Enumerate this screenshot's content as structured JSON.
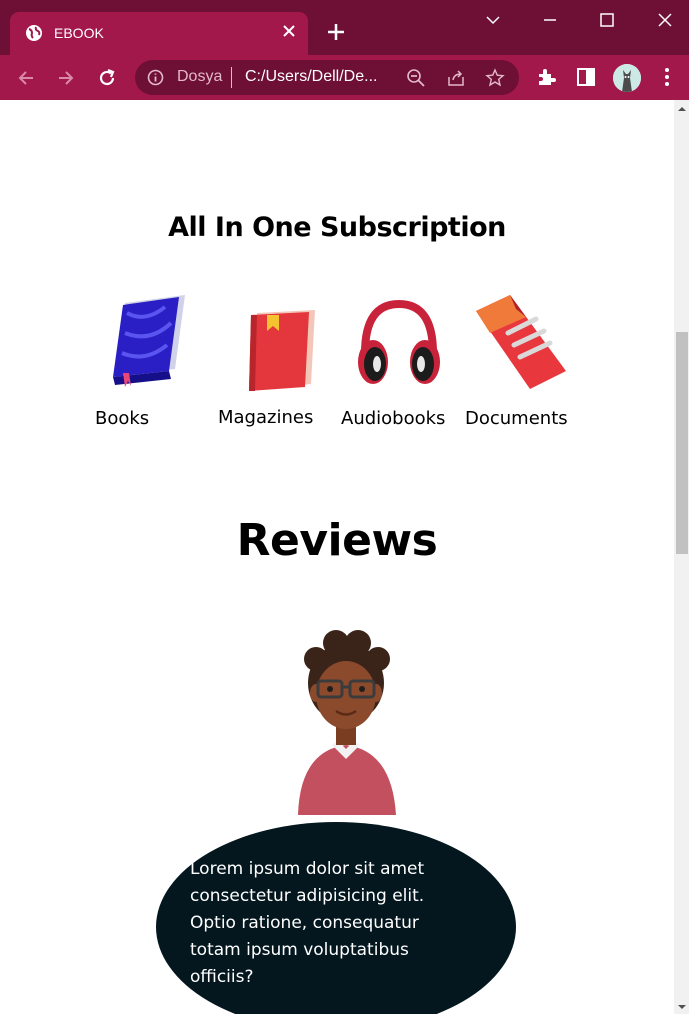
{
  "browser": {
    "tab_title": "EBOOK",
    "site_label": "Dosya",
    "url": "C:/Users/Dell/De...",
    "colors": {
      "titlebar": "#6e0f35",
      "toolbar": "#a3184b"
    }
  },
  "page": {
    "subscription_heading": "All In One Subscription",
    "categories": [
      {
        "label": "Books",
        "icon": "book-icon"
      },
      {
        "label": "Magazines",
        "icon": "magazine-icon"
      },
      {
        "label": "Audiobooks",
        "icon": "headphones-icon"
      },
      {
        "label": "Documents",
        "icon": "document-icon"
      }
    ],
    "reviews_heading": "Reviews",
    "review_text": "Lorem ipsum dolor sit amet consectetur adipisicing elit. Optio ratione, consequatur totam ipsum voluptatibus officiis?"
  }
}
